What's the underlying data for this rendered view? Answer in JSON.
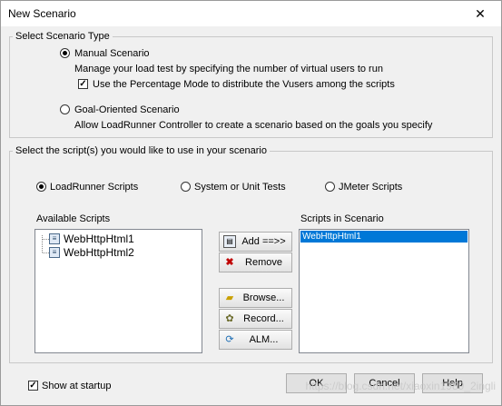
{
  "window": {
    "title": "New Scenario",
    "close_glyph": "✕"
  },
  "scenario_type": {
    "legend": "Select Scenario Type",
    "manual": {
      "label": "Manual Scenario",
      "selected": true,
      "description": "Manage your load test by specifying the number of virtual users to run",
      "percentage_mode_label": "Use the Percentage Mode to distribute the Vusers among the scripts",
      "percentage_mode_checked": true
    },
    "goal": {
      "label": "Goal-Oriented Scenario",
      "selected": false,
      "description": "Allow LoadRunner Controller to create a scenario based on the goals you specify"
    }
  },
  "scripts": {
    "legend": "Select the script(s) you would like to use in your scenario",
    "types": [
      {
        "label": "LoadRunner Scripts",
        "selected": true
      },
      {
        "label": "System or Unit Tests",
        "selected": false
      },
      {
        "label": "JMeter Scripts",
        "selected": false
      }
    ],
    "available_label": "Available Scripts",
    "available": [
      "WebHttpHtml1",
      "WebHttpHtml2"
    ],
    "in_scenario_label": "Scripts in Scenario",
    "in_scenario": [
      "WebHttpHtml1"
    ],
    "buttons": {
      "add": "Add ==>>",
      "remove": "Remove",
      "browse": "Browse...",
      "record": "Record...",
      "alm": "ALM..."
    }
  },
  "footer": {
    "show_at_startup_label": "Show at startup",
    "show_at_startup_checked": true,
    "ok": "OK",
    "cancel": "Cancel",
    "help": "Help"
  },
  "watermark": "https://blog.csdn.net/xiaoxin1989_2ingli",
  "check_glyph": "✓"
}
